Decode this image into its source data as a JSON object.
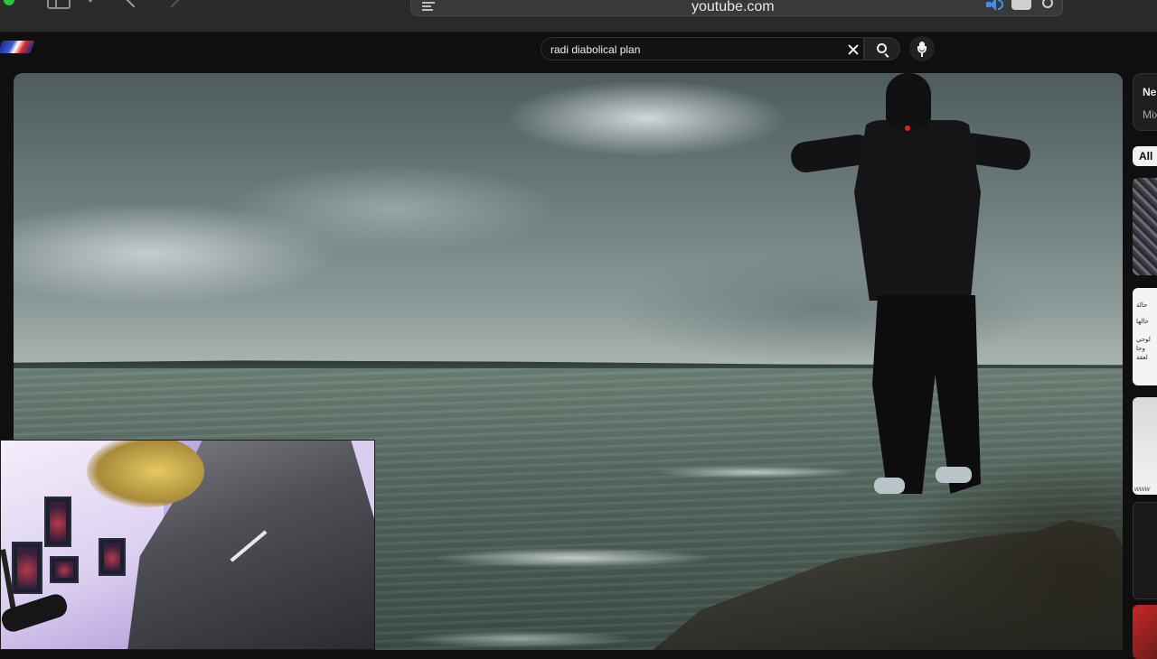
{
  "browser": {
    "url": "youtube.com"
  },
  "search": {
    "query": "radi diabolical plan"
  },
  "sidebar": {
    "next_card": {
      "title": "Ne",
      "subtitle": "Mix"
    },
    "chips": [
      "All"
    ],
    "thumb_texts": [
      "حالة",
      "حالها",
      "لوحي",
      "وحا",
      "لعقة",
      "www"
    ]
  },
  "colors": {
    "background": "#0f0f0f",
    "audio_accent": "#3b8cff",
    "traffic_green": "#28c840"
  }
}
